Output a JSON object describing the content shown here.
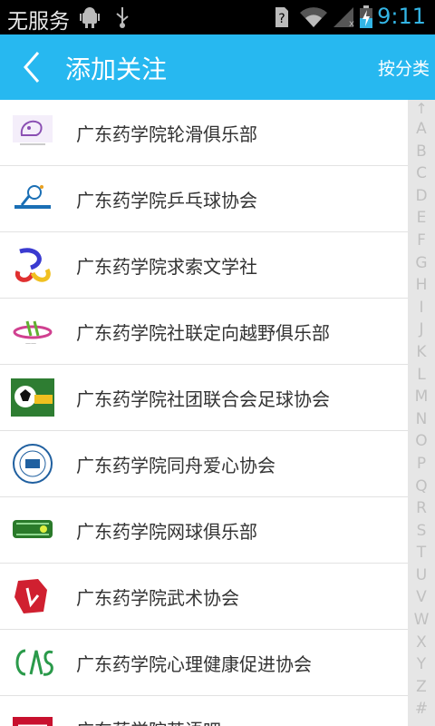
{
  "status_bar": {
    "carrier": "无服务",
    "time": "9:11",
    "accent": "#33b5e5"
  },
  "header": {
    "title": "添加关注",
    "action_label": "按分类",
    "back_icon": "chevron-left-icon",
    "color": "#27b8f0"
  },
  "clubs": [
    {
      "name": "广东药学院轮滑俱乐部",
      "logo": "roller-skate-logo"
    },
    {
      "name": "广东药学院乒乓球协会",
      "logo": "ping-pong-logo"
    },
    {
      "name": "广东药学院求索文学社",
      "logo": "literature-society-logo"
    },
    {
      "name": "广东药学院社联定向越野俱乐部",
      "logo": "orienteering-logo"
    },
    {
      "name": "广东药学院社团联合会足球协会",
      "logo": "football-logo"
    },
    {
      "name": "广东药学院同舟爱心协会",
      "logo": "charity-seal-logo"
    },
    {
      "name": "广东药学院网球俱乐部",
      "logo": "tennis-logo"
    },
    {
      "name": "广东药学院武术协会",
      "logo": "martial-arts-logo"
    },
    {
      "name": "广东药学院心理健康促进协会",
      "logo": "mental-health-logo"
    },
    {
      "name": "广东药学院英语吧",
      "logo": "english-club-logo"
    }
  ],
  "index_bar": {
    "top": "↑",
    "letters": [
      "A",
      "B",
      "C",
      "D",
      "E",
      "F",
      "G",
      "H",
      "I",
      "J",
      "K",
      "L",
      "M",
      "N",
      "O",
      "P",
      "Q",
      "R",
      "S",
      "T",
      "U",
      "V",
      "W",
      "X",
      "Y",
      "Z",
      "#"
    ]
  }
}
